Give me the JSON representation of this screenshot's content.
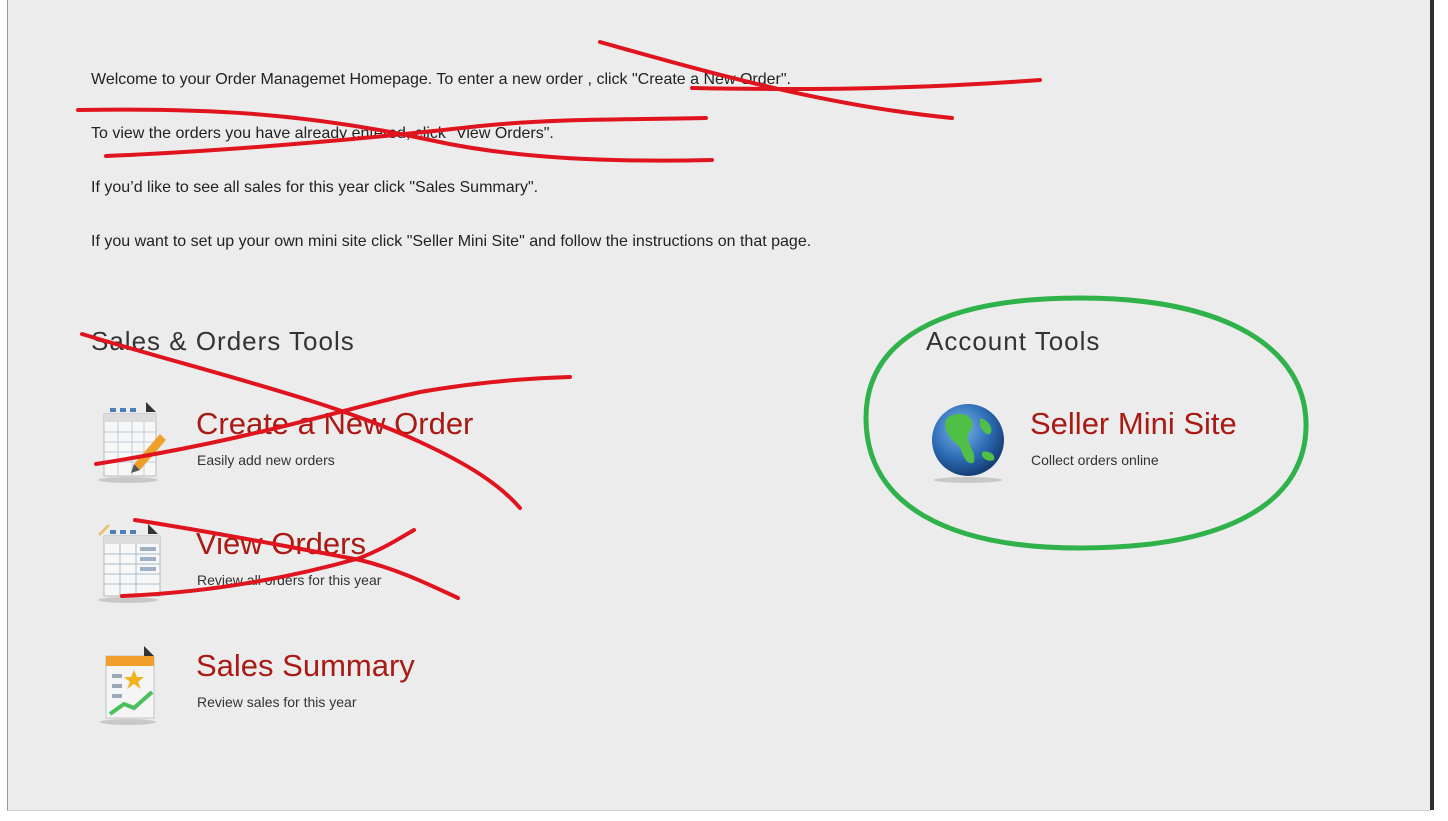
{
  "intro": {
    "line1": "Welcome to your Order Managemet Homepage. To enter a new order , click \"Create a New Order\".",
    "line2": "To view the orders you have already entered, click \"View Orders\".",
    "line3": "If you’d like to see all sales for this year click \"Sales Summary\".",
    "line4": "If you want to set up your own mini site click \"Seller Mini Site\" and follow the instructions on that page."
  },
  "sales_tools": {
    "heading": "Sales & Orders Tools",
    "items": [
      {
        "title": "Create a New Order",
        "desc": "Easily add new orders",
        "icon": "order-form-pencil-icon"
      },
      {
        "title": "View Orders",
        "desc": "Review all orders for this year",
        "icon": "orders-table-icon"
      },
      {
        "title": "Sales Summary",
        "desc": "Review sales for this year",
        "icon": "sales-chart-icon"
      }
    ]
  },
  "account_tools": {
    "heading": "Account Tools",
    "items": [
      {
        "title": "Seller Mini Site",
        "desc": "Collect orders online",
        "icon": "globe-icon"
      }
    ]
  },
  "colors": {
    "link": "#a81a14",
    "background": "#ececec",
    "strike_mark": "#e0141e",
    "circle_mark": "#2fb24a"
  }
}
